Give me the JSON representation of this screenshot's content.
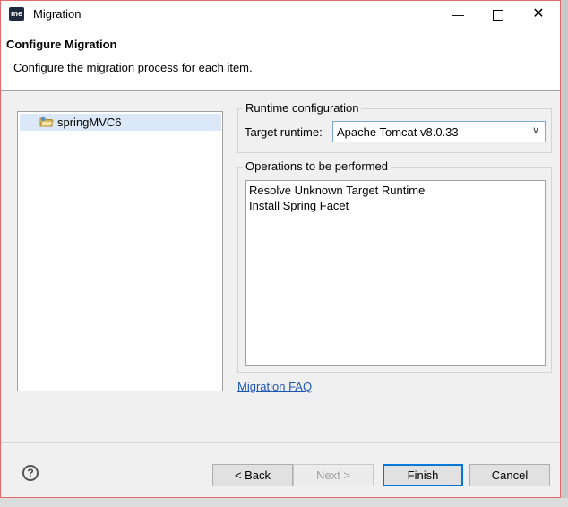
{
  "window": {
    "app_icon": "me",
    "title": "Migration",
    "minimize": "—",
    "close": "✕"
  },
  "header": {
    "title": "Configure Migration",
    "description": "Configure the migration process for each item."
  },
  "tree": {
    "items": [
      {
        "label": "springMVC6",
        "icon": "project-folder-icon"
      }
    ]
  },
  "runtime": {
    "group_label": "Runtime configuration",
    "target_label": "Target runtime:",
    "selected": "Apache Tomcat v8.0.33"
  },
  "operations": {
    "group_label": "Operations to be performed",
    "items": [
      "Resolve Unknown Target Runtime",
      "Install Spring Facet"
    ]
  },
  "faq_link": "Migration FAQ",
  "buttons": {
    "help": "?",
    "back": "< Back",
    "next": "Next >",
    "finish": "Finish",
    "cancel": "Cancel"
  },
  "colors": {
    "accent": "#0078d7",
    "link": "#1e56b5",
    "selection": "#dbe8f7"
  }
}
